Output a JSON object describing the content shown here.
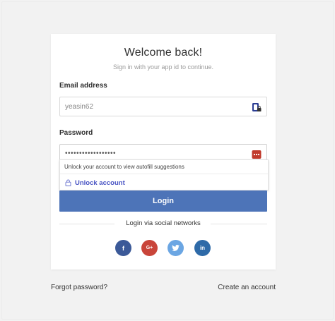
{
  "card": {
    "title": "Welcome back!",
    "subtitle": "Sign in with your app id to continue."
  },
  "email": {
    "label": "Email address",
    "value": "yeasin62"
  },
  "password": {
    "label": "Password",
    "value": "••••••••••••••••••"
  },
  "autofill": {
    "hint": "Unlock your account to view autofill suggestions",
    "unlock_label": "Unlock account"
  },
  "login_button": "Login",
  "social": {
    "divider_text": "Login via social networks",
    "networks": [
      {
        "name": "facebook",
        "glyph": "f",
        "color": "#3b5998"
      },
      {
        "name": "google-plus",
        "glyph": "G+",
        "color": "#c9453a"
      },
      {
        "name": "twitter",
        "glyph": "t",
        "color": "#6ba6e3"
      },
      {
        "name": "linkedin",
        "glyph": "in",
        "color": "#2e6aa8"
      }
    ]
  },
  "links": {
    "forgot": "Forgot password?",
    "create": "Create an account"
  },
  "colors": {
    "primary_button": "#4d74b8",
    "unlock_link": "#4a55c4",
    "password_manager_red": "#c0392b",
    "password_manager_blue": "#2c3e94"
  },
  "icons": {
    "email_field": "password-manager-lock-icon",
    "password_field": "password-manager-dots-icon",
    "unlock": "lock-icon"
  }
}
